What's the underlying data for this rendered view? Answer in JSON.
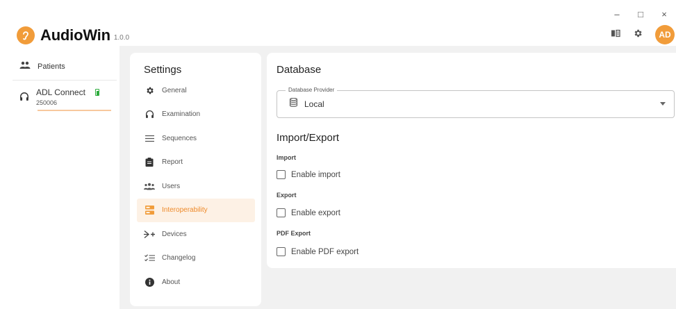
{
  "window": {
    "minimize_glyph": "–",
    "maximize_glyph": "□",
    "close_glyph": "×"
  },
  "header": {
    "app_name": "AudioWin",
    "version": "1.0.0",
    "avatar_initials": "AD",
    "icons": [
      "book-icon",
      "gear-icon"
    ]
  },
  "leftnav": {
    "patients_label": "Patients",
    "device": {
      "name": "ADL Connect",
      "serial": "250006"
    }
  },
  "settings": {
    "title": "Settings",
    "items": [
      {
        "label": "General",
        "icon": "gear-icon"
      },
      {
        "label": "Examination",
        "icon": "headphones-icon"
      },
      {
        "label": "Sequences",
        "icon": "list-icon"
      },
      {
        "label": "Report",
        "icon": "clipboard-icon"
      },
      {
        "label": "Users",
        "icon": "users-icon"
      },
      {
        "label": "Interoperability",
        "icon": "interoperability-icon"
      },
      {
        "label": "Devices",
        "icon": "devices-icon"
      },
      {
        "label": "Changelog",
        "icon": "changelog-icon"
      },
      {
        "label": "About",
        "icon": "info-icon"
      }
    ],
    "active_index": 5
  },
  "content": {
    "database_title": "Database",
    "provider_legend": "Database Provider",
    "provider_value": "Local",
    "import_export_title": "Import/Export",
    "import_label": "Import",
    "enable_import": "Enable import",
    "export_label": "Export",
    "enable_export": "Enable export",
    "pdf_export_label": "PDF Export",
    "enable_pdf_export": "Enable PDF export",
    "import_checked": false,
    "export_checked": false,
    "pdf_export_checked": false
  },
  "colors": {
    "accent": "#f19c3a",
    "active_bg": "#fdf1e5",
    "active_text": "#ee8a2a",
    "battery": "#2eac3e",
    "background": "#f1f1f1"
  }
}
